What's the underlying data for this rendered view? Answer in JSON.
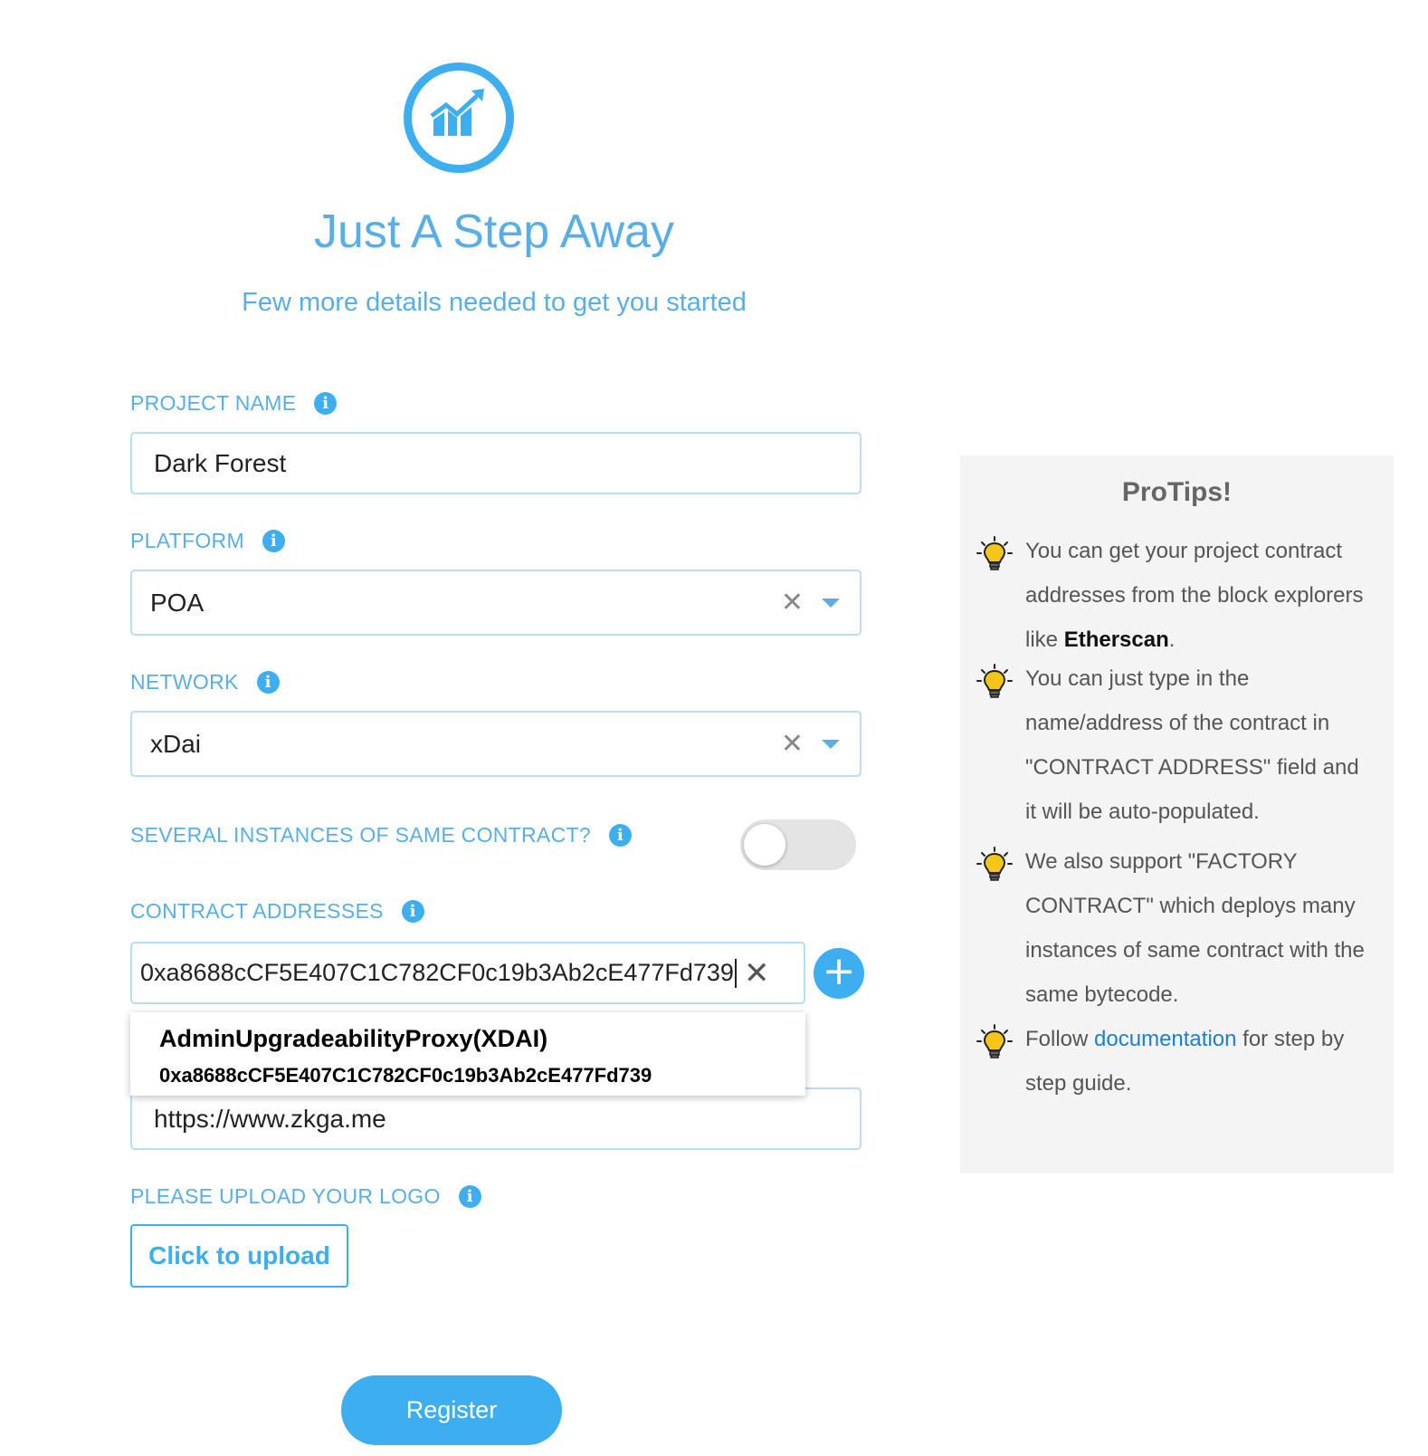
{
  "header": {
    "title": "Just A Step Away",
    "subtitle": "Few more details needed to get you started"
  },
  "form": {
    "project_name": {
      "label": "PROJECT NAME",
      "value": "Dark Forest"
    },
    "platform": {
      "label": "PLATFORM",
      "value": "POA"
    },
    "network": {
      "label": "NETWORK",
      "value": "xDai"
    },
    "several_instances": {
      "label": "SEVERAL INSTANCES OF SAME CONTRACT?",
      "enabled": false
    },
    "contract_addresses": {
      "label": "CONTRACT ADDRESSES",
      "value": "0xa8688cCF5E407C1C782CF0c19b3Ab2cE477Fd739",
      "suggestion": {
        "name": "AdminUpgradeabilityProxy(XDAI)",
        "address": "0xa8688cCF5E407C1C782CF0c19b3Ab2cE477Fd739"
      }
    },
    "website": {
      "value": "https://www.zkga.me"
    },
    "logo": {
      "label": "PLEASE UPLOAD YOUR LOGO",
      "button": "Click to upload"
    },
    "register_label": "Register"
  },
  "protips": {
    "title": "ProTips!",
    "tip1": {
      "before": "You can get your project contract addresses from the block explorers like ",
      "bold": "Etherscan",
      "after": "."
    },
    "tip2": "You can just type in the name/address of the contract in \"CONTRACT ADDRESS\" field and it will be auto-populated.",
    "tip3": "We also support \"FACTORY CONTRACT\" which deploys many instances of same contract with the same bytecode.",
    "tip4": {
      "before": "Follow ",
      "link": "documentation",
      "after": " for step by step guide."
    }
  },
  "colors": {
    "accent": "#3daeef",
    "label": "#5aaee6",
    "tip_bulb": "#f5c518"
  },
  "icons": {
    "info": "info-icon",
    "bulb": "lightbulb-icon",
    "clear": "close-icon",
    "dropdown": "chevron-down-icon",
    "add": "plus-icon",
    "logo": "chart-growth-icon"
  }
}
